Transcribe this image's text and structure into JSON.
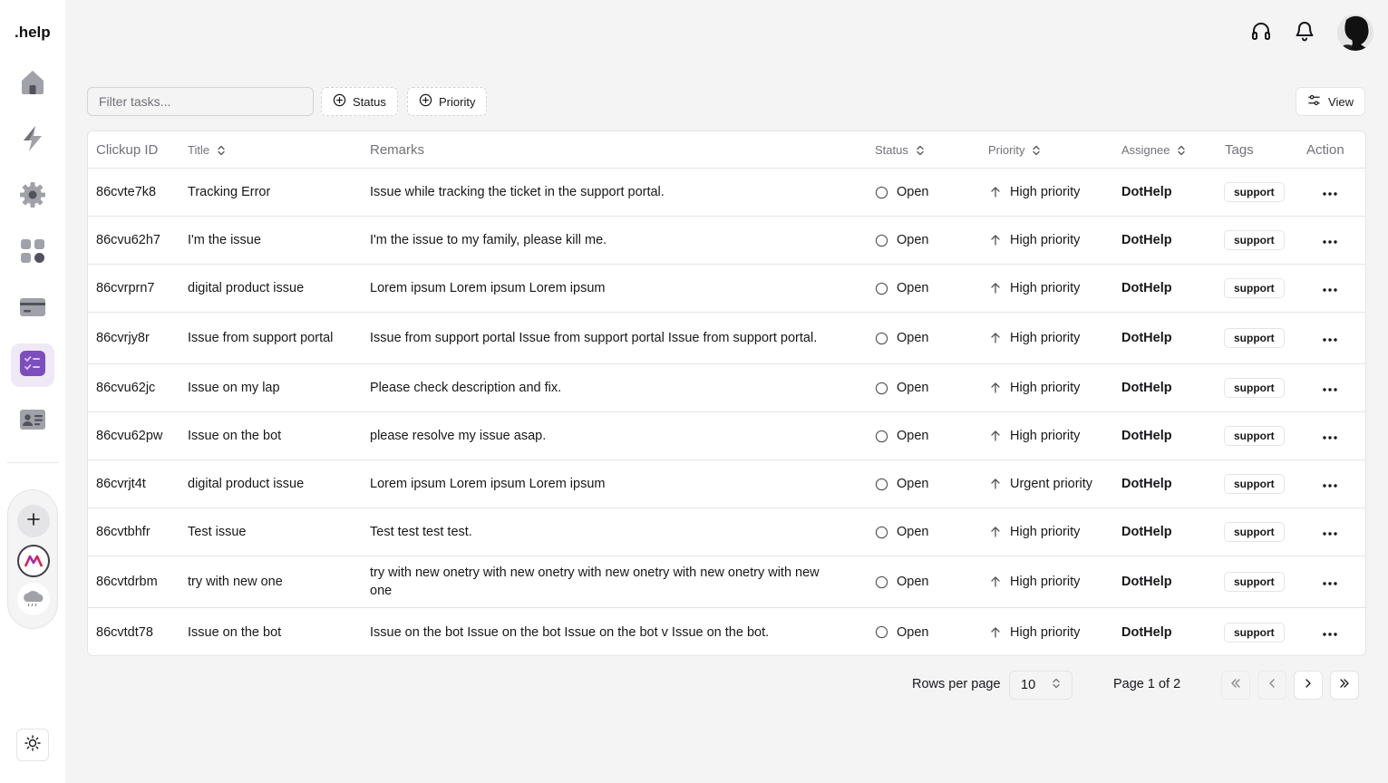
{
  "app": {
    "brand": ".help"
  },
  "sidebar": {
    "items": [
      {
        "icon": "home-icon",
        "active": false
      },
      {
        "icon": "lightning-icon",
        "active": false
      },
      {
        "icon": "gear-icon",
        "active": false
      },
      {
        "icon": "apps-grid-icon",
        "active": false
      },
      {
        "icon": "credit-card-icon",
        "active": false
      },
      {
        "icon": "tasks-checklist-icon",
        "active": true
      },
      {
        "icon": "contact-card-icon",
        "active": false
      }
    ],
    "workspace": {
      "add_label": "+",
      "logo_letter": "M"
    }
  },
  "header": {
    "icons": [
      "headset-icon",
      "bell-icon"
    ]
  },
  "toolbar": {
    "filter_placeholder": "Filter tasks...",
    "filter_value": "",
    "status_label": "Status",
    "priority_label": "Priority",
    "view_label": "View"
  },
  "table": {
    "columns": {
      "clickup_id": "Clickup ID",
      "title": "Title",
      "remarks": "Remarks",
      "status": "Status",
      "priority": "Priority",
      "assignee": "Assignee",
      "tags": "Tags",
      "action": "Action"
    },
    "rows": [
      {
        "id": "86cvte7k8",
        "title": "Tracking Error",
        "remarks": "Issue while tracking the ticket in the support portal.",
        "status": "Open",
        "priority": "High priority",
        "assignee": "DotHelp",
        "tag": "support"
      },
      {
        "id": "86cvu62h7",
        "title": "I'm the issue",
        "remarks": "I'm the issue to my family, please kill me.",
        "status": "Open",
        "priority": "High priority",
        "assignee": "DotHelp",
        "tag": "support"
      },
      {
        "id": "86cvrprn7",
        "title": "digital product issue",
        "remarks": "Lorem ipsum Lorem ipsum Lorem ipsum",
        "status": "Open",
        "priority": "High priority",
        "assignee": "DotHelp",
        "tag": "support"
      },
      {
        "id": "86cvrjy8r",
        "title": "Issue from support portal",
        "remarks": "Issue from support portal Issue from support portal Issue from support portal.",
        "status": "Open",
        "priority": "High priority",
        "assignee": "DotHelp",
        "tag": "support"
      },
      {
        "id": "86cvu62jc",
        "title": "Issue on my lap",
        "remarks": "Please check description and fix.",
        "status": "Open",
        "priority": "High priority",
        "assignee": "DotHelp",
        "tag": "support"
      },
      {
        "id": "86cvu62pw",
        "title": "Issue on the bot",
        "remarks": "please resolve my issue asap.",
        "status": "Open",
        "priority": "High priority",
        "assignee": "DotHelp",
        "tag": "support"
      },
      {
        "id": "86cvrjt4t",
        "title": "digital product issue",
        "remarks": "Lorem ipsum Lorem ipsum Lorem ipsum",
        "status": "Open",
        "priority": "Urgent priority",
        "assignee": "DotHelp",
        "tag": "support"
      },
      {
        "id": "86cvtbhfr",
        "title": "Test issue",
        "remarks": "Test test test test.",
        "status": "Open",
        "priority": "High priority",
        "assignee": "DotHelp",
        "tag": "support"
      },
      {
        "id": "86cvtdrbm",
        "title": "try with new one",
        "remarks": "try with new onetry with new onetry with new onetry with new onetry with new one",
        "status": "Open",
        "priority": "High priority",
        "assignee": "DotHelp",
        "tag": "support"
      },
      {
        "id": "86cvtdt78",
        "title": "Issue on the bot",
        "remarks": "Issue on the bot Issue on the bot Issue on the bot v Issue on the bot.",
        "status": "Open",
        "priority": "High priority",
        "assignee": "DotHelp",
        "tag": "support"
      }
    ]
  },
  "pagination": {
    "rows_per_page_label": "Rows per page",
    "rows_per_page_value": "10",
    "page_label": "Page 1 of 2"
  },
  "colors": {
    "accent": "#7c4dbd",
    "accent_bg": "#efe9f6",
    "border": "#e4e4e7",
    "muted_text": "#71717a"
  }
}
